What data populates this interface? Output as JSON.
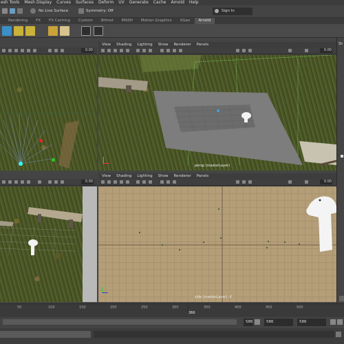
{
  "menubar": [
    "esh Tools",
    "Mesh Display",
    "Curves",
    "Surfaces",
    "Deform",
    "UV",
    "Generate",
    "Cache",
    "Arnold",
    "Help"
  ],
  "statusline": {
    "live_surface": "No Live Surface",
    "symmetry": "Symmetry: Off",
    "sign_in": "Sign In"
  },
  "shelf_tabs": [
    "Rendering",
    "FX",
    "FX Caching",
    "Custom",
    "Bifrost",
    "MASH",
    "Motion Graphics",
    "XGen",
    "Arnold"
  ],
  "active_shelf_tab": "Arnold",
  "viewport_menu": [
    "View",
    "Shading",
    "Lighting",
    "Show",
    "Renderer",
    "Panels"
  ],
  "viewports": {
    "top_left": {
      "field": "0.00"
    },
    "top_right": {
      "field": "0.00",
      "label": "persp (masterLayer)"
    },
    "bottom_left": {
      "field": "0.00"
    },
    "bottom_right": {
      "field": "0.00",
      "label": "side (masterLayer) -X"
    }
  },
  "timeline": {
    "ticks": [
      "50",
      "100",
      "150",
      "200",
      "250",
      "300",
      "350",
      "400",
      "450",
      "500"
    ],
    "current_frame": "366"
  },
  "range": {
    "start": "586",
    "end": "586",
    "max": "586"
  },
  "right_panel": {
    "tab": "Sh"
  },
  "colors": {
    "maya_bg": "#444444",
    "grid_tan": "#b49e78",
    "plane_gray": "#7d7d7d",
    "highlight": "#3da3e0"
  }
}
